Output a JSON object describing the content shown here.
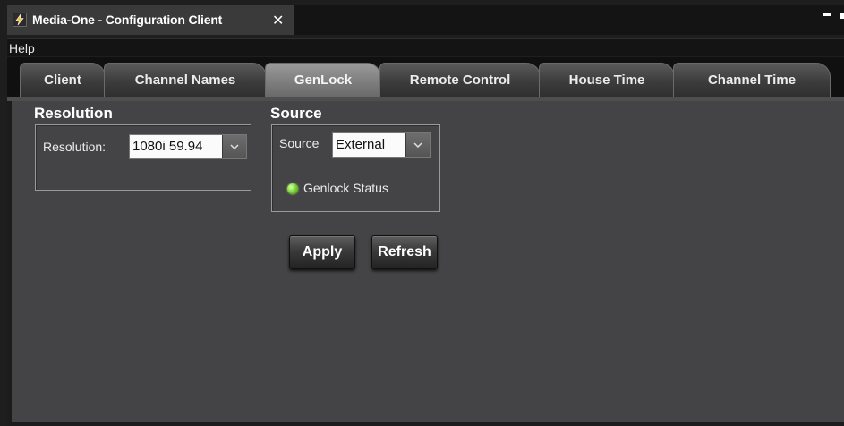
{
  "window": {
    "title": "Media-One - Configuration Client",
    "close_glyph": "✕",
    "app_icon": "lightning-bolt-icon"
  },
  "menu": {
    "items": [
      {
        "label": "Help"
      }
    ]
  },
  "tabs": [
    {
      "label": "Client",
      "active": false
    },
    {
      "label": "Channel Names",
      "active": false
    },
    {
      "label": "GenLock",
      "active": true
    },
    {
      "label": "Remote Control",
      "active": false
    },
    {
      "label": "House Time",
      "active": false
    },
    {
      "label": "Channel Time",
      "active": false
    }
  ],
  "resolution_group": {
    "title": "Resolution",
    "field_label": "Resolution:",
    "value": "1080i 59.94"
  },
  "source_group": {
    "title": "Source",
    "field_label": "Source",
    "value": "External",
    "status_label": "Genlock Status",
    "status_color": "#76d230"
  },
  "actions": {
    "apply": "Apply",
    "refresh": "Refresh"
  }
}
